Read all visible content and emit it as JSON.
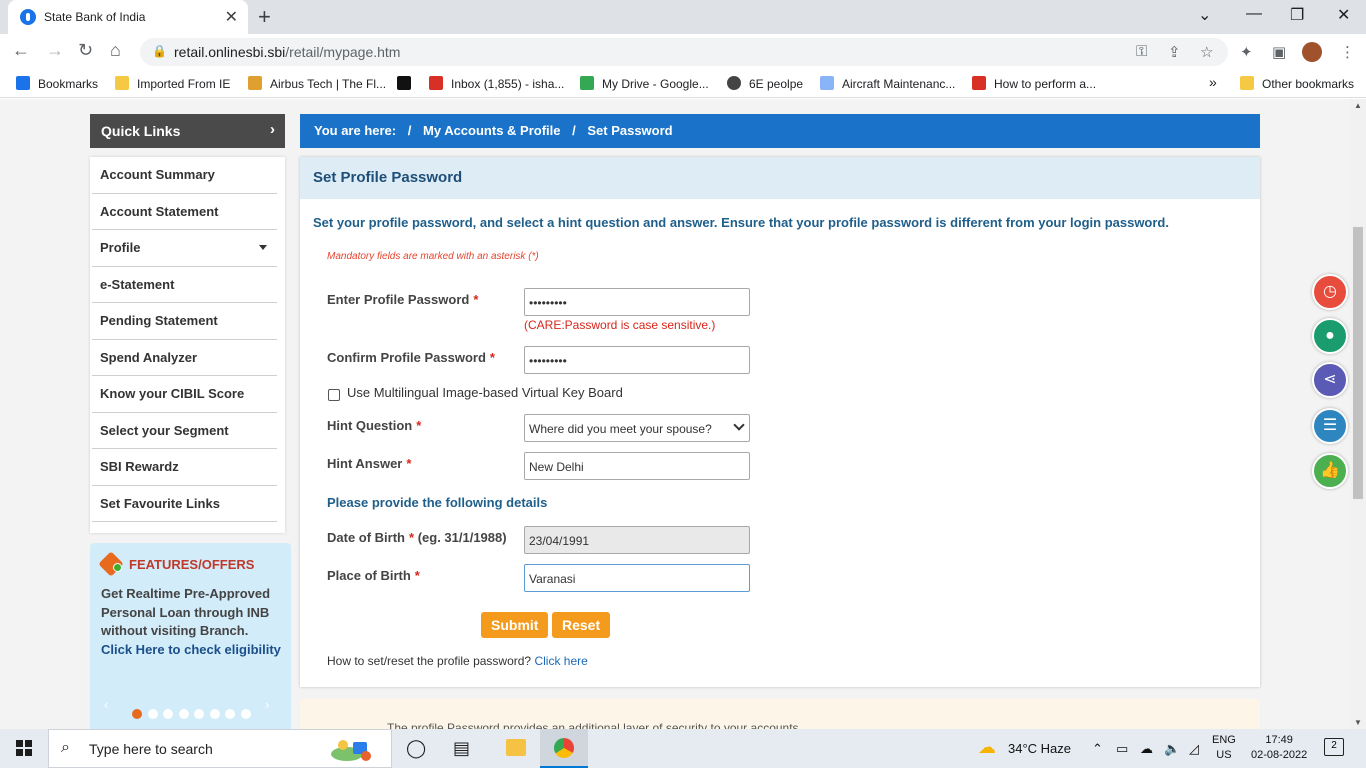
{
  "browser": {
    "tab_title": "State Bank of India",
    "url_host": "retail.onlinesbi.sbi",
    "url_path": "/retail/mypage.htm",
    "bookmarks": [
      {
        "label": "Bookmarks",
        "color": "#1a73e8"
      },
      {
        "label": "Imported From IE",
        "color": "#f6c945"
      },
      {
        "label": "Airbus Tech | The Fl...",
        "color": "#e0a030"
      },
      {
        "label": "",
        "color": "#111111"
      },
      {
        "label": "Inbox (1,855) - isha...",
        "color": "#d93025"
      },
      {
        "label": "My Drive - Google...",
        "color": "#34a853"
      },
      {
        "label": "6E peolpe",
        "color": "#444444"
      },
      {
        "label": "Aircraft Maintenanc...",
        "color": "#8ab4f8"
      },
      {
        "label": "How to perform a...",
        "color": "#d93025"
      }
    ],
    "bookmarks_more": "»",
    "other_bookmarks": "Other bookmarks"
  },
  "quick_links": {
    "title": "Quick Links",
    "items": [
      "Account Summary",
      "Account Statement",
      "Profile",
      "e-Statement",
      "Pending Statement",
      "Spend Analyzer",
      "Know your CIBIL Score",
      "Select your Segment",
      "SBI Rewardz",
      "Set Favourite Links"
    ]
  },
  "offers": {
    "title": "FEATURES/OFFERS",
    "text": "Get Realtime Pre-Approved Personal Loan through INB without visiting Branch.",
    "link": "Click Here to check eligibility",
    "active_slide": 1,
    "total_slides": 8
  },
  "breadcrumb": {
    "prefix": "You are here:",
    "sep": "/",
    "section": "My Accounts & Profile",
    "page": "Set Password"
  },
  "form": {
    "heading": "Set Profile Password",
    "intro": "Set your profile password, and select a hint question and answer. Ensure that your profile password is different from your login password.",
    "mandatory_note": "Mandatory fields are marked with an asterisk (*)",
    "password_label": "Enter Profile Password",
    "password_value": "•••••••••",
    "care_note": "(CARE:Password is case sensitive.)",
    "confirm_label": "Confirm Profile Password",
    "confirm_value": "•••••••••",
    "keyboard_label": "Use Multilingual Image-based Virtual Key Board",
    "hint_q_label": "Hint Question",
    "hint_q_value": "Where did you meet your spouse?",
    "hint_a_label": "Hint Answer",
    "hint_a_value": "New Delhi",
    "details_heading": "Please provide the following details",
    "dob_label": "Date of Birth",
    "dob_hint": "(eg. 31/1/1988)",
    "dob_value": "23/04/1991",
    "pob_label": "Place of Birth",
    "pob_value": "Varanasi",
    "asterisk": "*",
    "submit": "Submit",
    "reset": "Reset",
    "help_text": "How to set/reset the profile password?",
    "help_link": "Click here"
  },
  "bottom_note": "The profile Password provides an additional layer of security to your accounts",
  "fabs": [
    {
      "name": "clock-icon",
      "color": "#e74c3c"
    },
    {
      "name": "lightbulb-icon",
      "color": "#1a9c6e"
    },
    {
      "name": "share-icon",
      "color": "#5b5bb5"
    },
    {
      "name": "list-icon",
      "color": "#2e86c1"
    },
    {
      "name": "thumbs-up-icon",
      "color": "#4caf50"
    }
  ],
  "taskbar": {
    "search_placeholder": "Type here to search",
    "weather": "34°C  Haze",
    "lang_top": "ENG",
    "lang_bottom": "US",
    "time": "17:49",
    "date": "02-08-2022",
    "notifications": "2"
  }
}
